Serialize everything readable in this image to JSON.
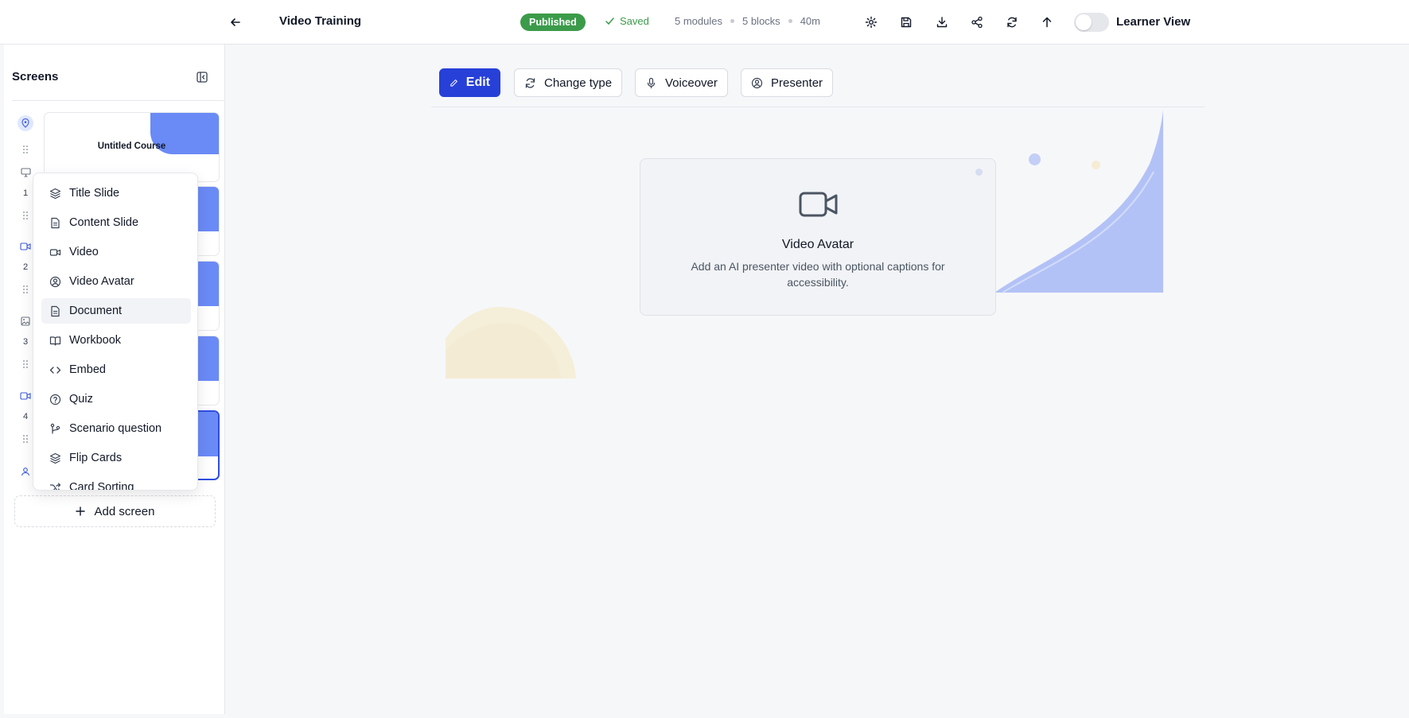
{
  "header": {
    "title": "Video Training",
    "status": "Published",
    "saved": "Saved",
    "modules": "5 modules",
    "blocks": "5 blocks",
    "duration": "40m",
    "learner_view_label": "Learner View"
  },
  "sidebar": {
    "title": "Screens",
    "rail_numbers": [
      "1",
      "2",
      "3",
      "4"
    ],
    "first_thumb_title": "Untitled Course",
    "add_screen_label": "Add screen"
  },
  "menu": {
    "items": [
      {
        "label": "Title Slide",
        "icon": "layers-icon"
      },
      {
        "label": "Content Slide",
        "icon": "file-icon"
      },
      {
        "label": "Video",
        "icon": "video-icon"
      },
      {
        "label": "Video Avatar",
        "icon": "user-circle-icon"
      },
      {
        "label": "Document",
        "icon": "file-icon"
      },
      {
        "label": "Workbook",
        "icon": "book-icon"
      },
      {
        "label": "Embed",
        "icon": "code-icon"
      },
      {
        "label": "Quiz",
        "icon": "question-circle-icon"
      },
      {
        "label": "Scenario question",
        "icon": "branch-icon"
      },
      {
        "label": "Flip Cards",
        "icon": "layers-icon"
      },
      {
        "label": "Card Sorting",
        "icon": "shuffle-icon"
      }
    ],
    "hovered": "Document"
  },
  "toolbar": {
    "edit": "Edit",
    "change_type": "Change type",
    "voiceover": "Voiceover",
    "presenter": "Presenter"
  },
  "canvas": {
    "card_title": "Video Avatar",
    "card_description": "Add an AI presenter video with optional captions for accessibility."
  },
  "colors": {
    "primary": "#2740d8",
    "published": "#3b9b4a",
    "thumb_accent": "#6a8af6",
    "deco_blue": "#b3c2f6",
    "deco_yellow": "#f5eed8"
  }
}
